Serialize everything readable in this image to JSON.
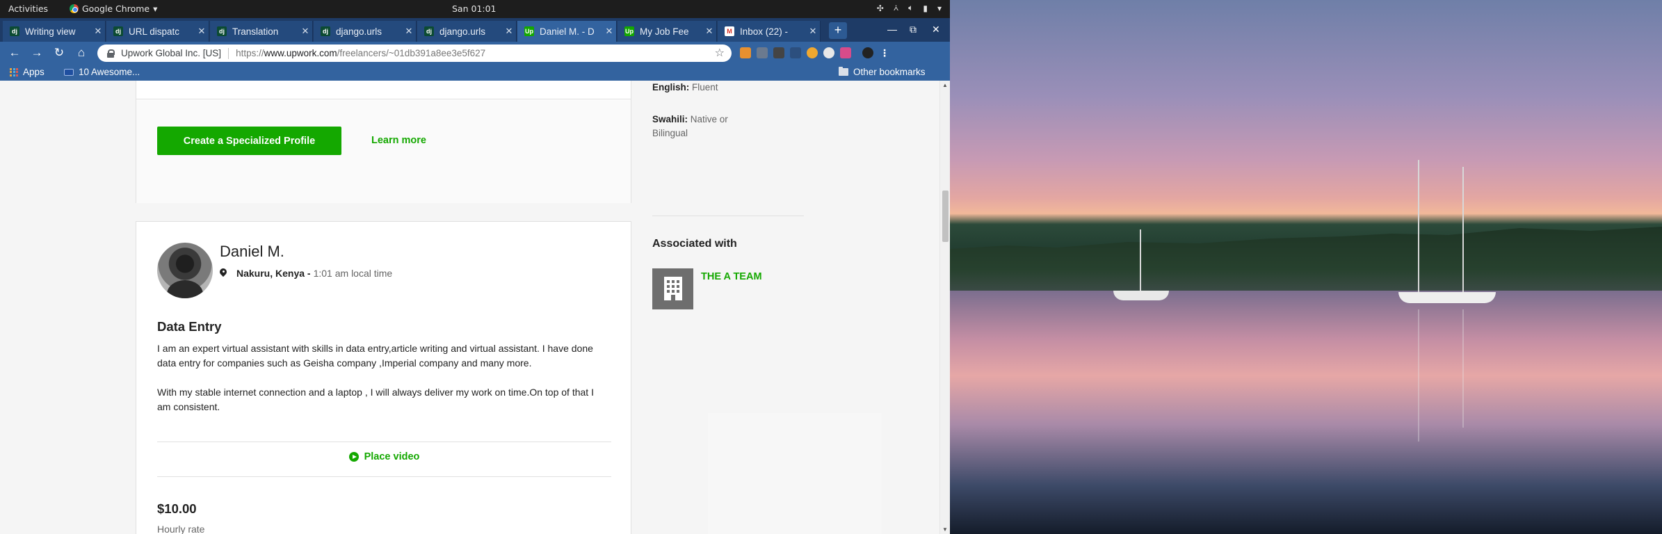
{
  "system": {
    "activities": "Activities",
    "app_name": "Google Chrome",
    "clock": "San 01:01"
  },
  "tabs": [
    {
      "title": "Writing view",
      "favicon": "dj",
      "active": false
    },
    {
      "title": "URL dispatc",
      "favicon": "dj",
      "active": false
    },
    {
      "title": "Translation",
      "favicon": "dj",
      "active": false
    },
    {
      "title": "django.urls",
      "favicon": "dj",
      "active": false
    },
    {
      "title": "django.urls",
      "favicon": "dj",
      "active": false
    },
    {
      "title": "Daniel M. - D",
      "favicon": "up",
      "active": true
    },
    {
      "title": "My Job Fee",
      "favicon": "up",
      "active": false
    },
    {
      "title": "Inbox (22) -",
      "favicon": "gmail",
      "active": false
    }
  ],
  "address_bar": {
    "site_identity": "Upwork Global Inc. [US]",
    "url_prefix": "https://",
    "url_host": "www.upwork.com",
    "url_path": "/freelancers/~01db391a8ee3e5f627"
  },
  "bookmarks": {
    "apps": "Apps",
    "item1": "10 Awesome...",
    "other": "Other bookmarks"
  },
  "profile": {
    "create_button": "Create a Specialized Profile",
    "learn_more": "Learn more",
    "name": "Daniel M.",
    "location": "Nakuru, Kenya -",
    "local_time": "1:01 am local time",
    "headline": "Data Entry",
    "desc_p1": "I am an expert virtual assistant with skills in data entry,article writing and virtual assistant. I have done data entry for companies such as Geisha company ,Imperial company and many more.",
    "desc_p2": "With my stable internet connection and a laptop , I will always deliver my work on time.On top of that I am consistent.",
    "place_video": "Place video",
    "rate": "$10.00",
    "rate_label": "Hourly rate"
  },
  "sidebar": {
    "languages": [
      {
        "name": "English:",
        "level": "Fluent"
      },
      {
        "name": "Swahili:",
        "level": "Native or Bilingual"
      }
    ],
    "associated_title": "Associated with",
    "agency": "THE A TEAM"
  },
  "colors": {
    "upwork_green": "#14a800",
    "chrome_frame": "#33639f"
  }
}
